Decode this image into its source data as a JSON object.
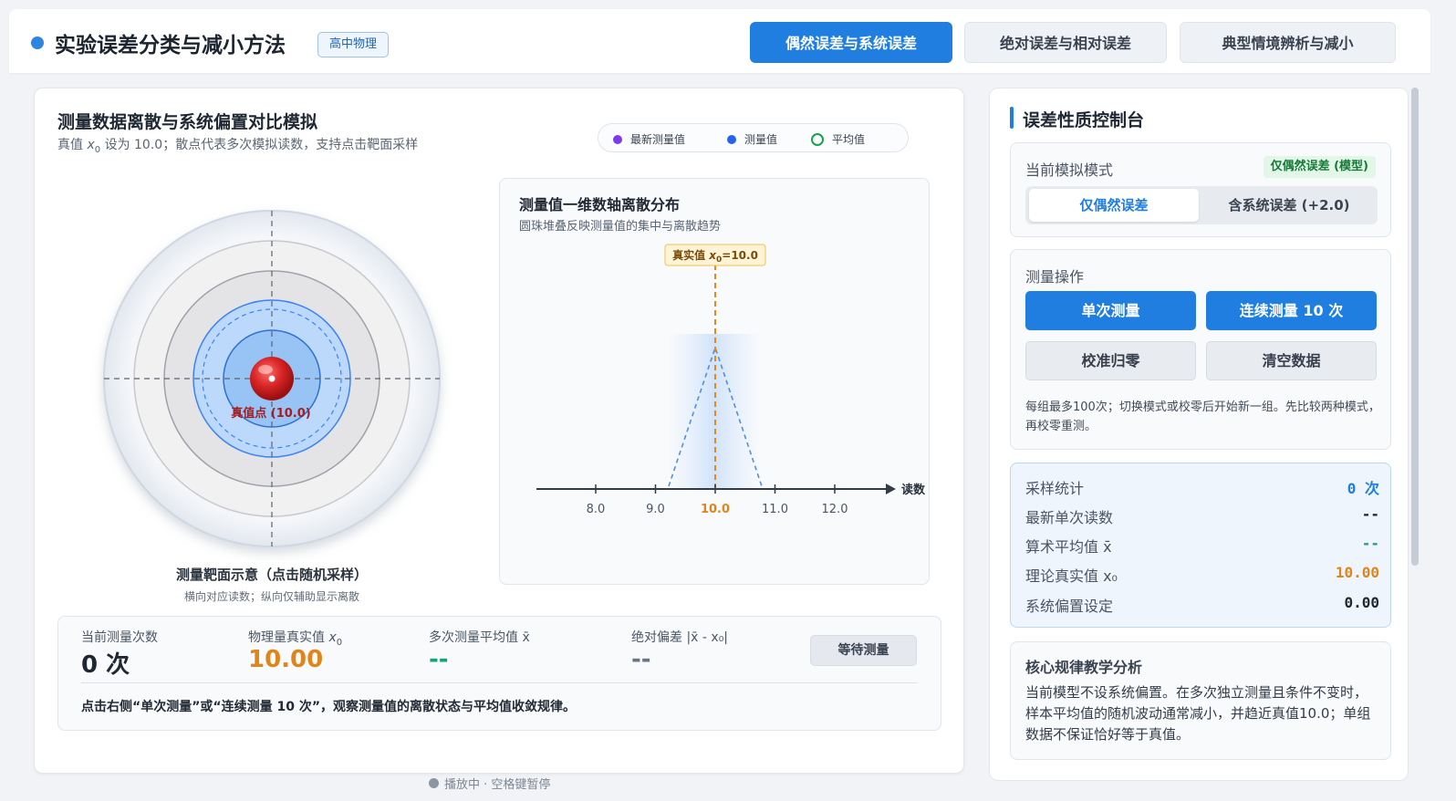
{
  "header": {
    "title": "实验误差分类与减小方法",
    "badge": "高中物理",
    "tabs": [
      {
        "label": "偶然误差与系统误差",
        "active": true
      },
      {
        "label": "绝对误差与相对误差",
        "active": false
      },
      {
        "label": "典型情境辨析与减小",
        "active": false
      }
    ]
  },
  "main": {
    "title": "测量数据离散与系统偏置对比模拟",
    "subtitle_pre": "真值 ",
    "subtitle_var": "x",
    "subtitle_sub": "0",
    "subtitle_post": " 设为 10.0；散点代表多次模拟读数，支持点击靶面采样",
    "legend": [
      {
        "label": "最新测量值",
        "color": "#7c3aed",
        "style": "filled"
      },
      {
        "label": "测量值",
        "color": "#2563eb",
        "style": "filled"
      },
      {
        "label": "平均值",
        "color": "#16a34a",
        "style": "ring"
      }
    ],
    "target": {
      "center_label": "真值点 (10.0)",
      "caption": "测量靶面示意（点击随机采样）",
      "hint": "横向对应读数；纵向仅辅助显示离散"
    },
    "axis_panel": {
      "title": "测量值一维数轴离散分布",
      "subtitle": "圆珠堆叠反映测量值的集中与离散趋势",
      "true_value_label_pre": "真实值 ",
      "true_value_label_var": "x",
      "true_value_label_sub": "0",
      "true_value_label_post": "=10.0",
      "axis_label": "读数",
      "ticks": [
        "8.0",
        "9.0",
        "10.0",
        "11.0",
        "12.0"
      ],
      "highlight_tick": "10.0"
    },
    "stats": {
      "count_label": "当前测量次数",
      "count_value": "0 次",
      "true_label_pre": "物理量真实值 ",
      "true_label_var": "x",
      "true_label_sub": "0",
      "true_value": "10.00",
      "mean_label": "多次测量平均值 x̄",
      "mean_value": "--",
      "abs_label": "绝对偏差 |x̄ - x₀|",
      "abs_value": "--",
      "status_button": "等待测量",
      "hint": "点击右侧“单次测量”或“连续测量 10 次”，观察测量值的离散状态与平均值收敛规律。"
    },
    "playing": "播放中 · 空格键暂停"
  },
  "panel": {
    "title": "误差性质控制台",
    "mode": {
      "label": "当前模拟模式",
      "badge": "仅偶然误差 (模型)",
      "options": [
        {
          "label": "仅偶然误差",
          "selected": true
        },
        {
          "label": "含系统误差 (+2.0)",
          "selected": false
        }
      ]
    },
    "ops": {
      "label": "测量操作",
      "single": "单次测量",
      "ten": "连续测量 10 次",
      "calibrate": "校准归零",
      "clear": "清空数据",
      "note": "每组最多100次；切换模式或校零后开始新一组。先比较两种模式，再校零重测。"
    },
    "sampling": {
      "rows": [
        {
          "key": "采样统计",
          "value": "0 次",
          "color": "#1f7ee0"
        },
        {
          "key": "最新单次读数",
          "value": "--",
          "color": "#1f2733"
        },
        {
          "key": "算术平均值 x̄",
          "value": "--",
          "color": "#15a37b"
        },
        {
          "key": "理论真实值 x₀",
          "value": "10.00",
          "color": "#e0851a"
        },
        {
          "key": "系统偏置设定",
          "value": "0.00",
          "color": "#1f2733"
        }
      ]
    },
    "analysis": {
      "title": "核心规律教学分析",
      "text": "当前模型不设系统偏置。在多次独立测量且条件不变时，样本平均值的随机波动通常减小，并趋近真值10.0；单组数据不保证恰好等于真值。"
    }
  },
  "colors": {
    "accent": "#1f7ee0",
    "true_value": "#e0851a",
    "mean": "#15a37b",
    "target_red": "#d42323"
  }
}
